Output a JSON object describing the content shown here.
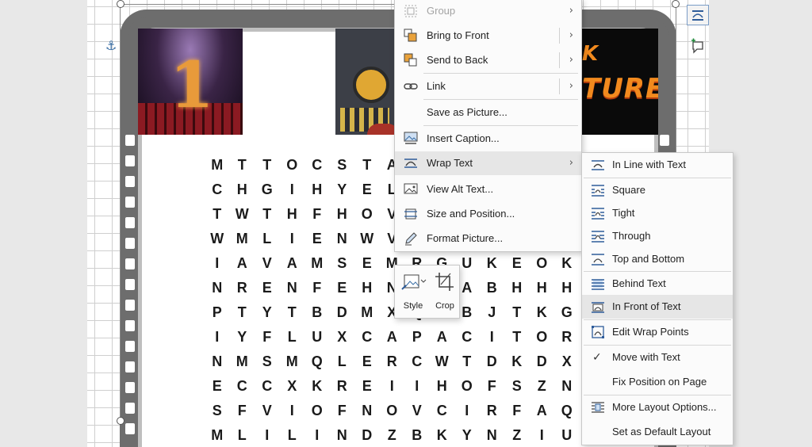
{
  "context_menu": {
    "items": [
      {
        "label": "Group",
        "disabled": true,
        "submenu": true
      },
      {
        "label": "Bring to Front",
        "submenu": true
      },
      {
        "label": "Send to Back",
        "submenu": true
      },
      {
        "label": "Link",
        "submenu": true
      },
      {
        "label": "Save as Picture..."
      },
      {
        "label": "Insert Caption..."
      },
      {
        "label": "Wrap Text",
        "submenu": true,
        "highlighted": true
      },
      {
        "label": "View Alt Text..."
      },
      {
        "label": "Size and Position..."
      },
      {
        "label": "Format Picture..."
      }
    ]
  },
  "wrap_menu": {
    "items": [
      {
        "label": "In Line with Text"
      },
      {
        "label": "Square"
      },
      {
        "label": "Tight"
      },
      {
        "label": "Through"
      },
      {
        "label": "Top and Bottom"
      },
      {
        "label": "Behind Text"
      },
      {
        "label": "In Front of Text",
        "highlighted": true
      },
      {
        "label": "Edit Wrap Points"
      },
      {
        "label": "Move with Text",
        "checked": true
      },
      {
        "label": "Fix Position on Page"
      },
      {
        "label": "More Layout Options..."
      },
      {
        "label": "Set as Default Layout"
      }
    ]
  },
  "mini_toolbar": {
    "style_label": "Style",
    "crop_label": "Crop"
  },
  "pictures": {
    "theater_number": "1",
    "bttf_top": "K",
    "bttf_bottom": "TURE"
  },
  "word_search": {
    "rows": [
      "MTTOCSTA",
      "CHGIHYEL",
      "TWTHFHOV",
      "WMLIENWV",
      "IAVAMSEMRGUKEOKY",
      "NRENFEHNPRABHHH",
      "PTYTBDMXQDBJTKG",
      "IYFLUXCAPACITOR",
      "NMSMQLERCWTDKDXA",
      "ECCXKREIIHOFSZN",
      "SFVIOFNOVCIRFAQI",
      "MLILINDZBKYNZIUS"
    ]
  },
  "colors": {
    "accent": "#2e5c9a",
    "menu_bg": "#fbfbfb",
    "highlight": "#e6e6e6",
    "frame": "#6d6d6d"
  },
  "icons": {
    "anchor": "⚓",
    "chevron": "›",
    "check": "✓"
  }
}
